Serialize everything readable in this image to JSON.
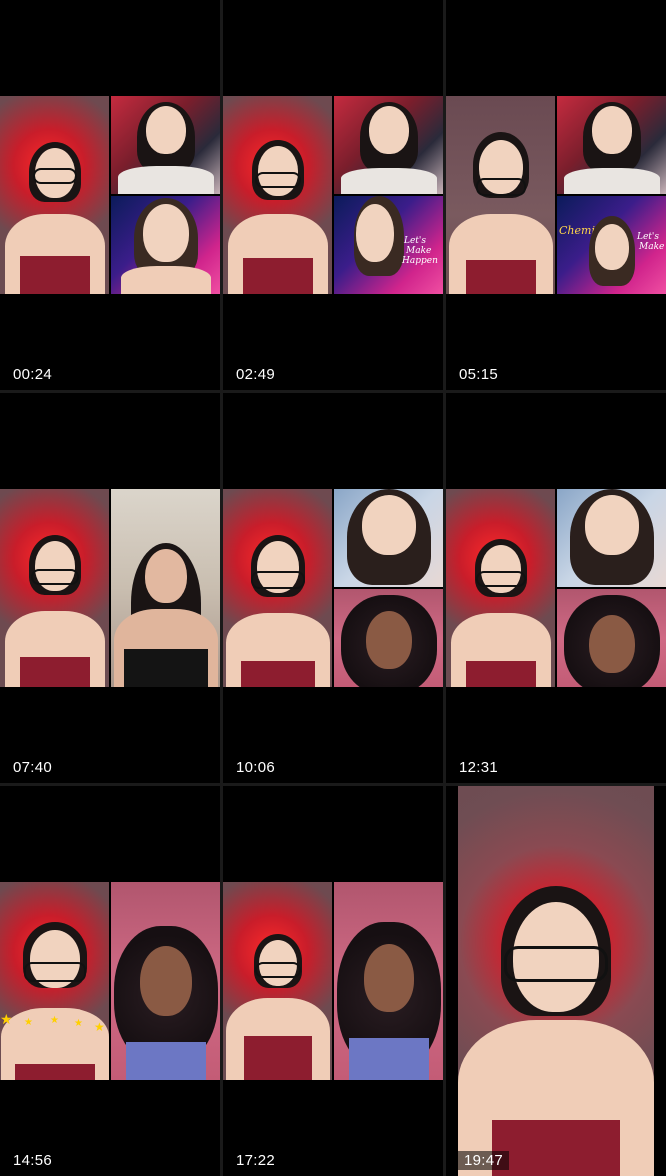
{
  "tiles": [
    {
      "timestamp": "00:24",
      "layout": "three"
    },
    {
      "timestamp": "02:49",
      "layout": "three"
    },
    {
      "timestamp": "05:15",
      "layout": "three"
    },
    {
      "timestamp": "07:40",
      "layout": "two"
    },
    {
      "timestamp": "10:06",
      "layout": "three"
    },
    {
      "timestamp": "12:31",
      "layout": "three"
    },
    {
      "timestamp": "14:56",
      "layout": "two"
    },
    {
      "timestamp": "17:22",
      "layout": "two"
    },
    {
      "timestamp": "19:47",
      "layout": "full"
    }
  ],
  "overlay_texts": {
    "poster_line1": "Let's",
    "poster_line2": "Make",
    "poster_line3": "Happen",
    "poster_banner": "Chemiah"
  },
  "colors": {
    "background": "#000000",
    "timestamp_text": "#ffffff",
    "red_glow": "#ff2a2a"
  }
}
